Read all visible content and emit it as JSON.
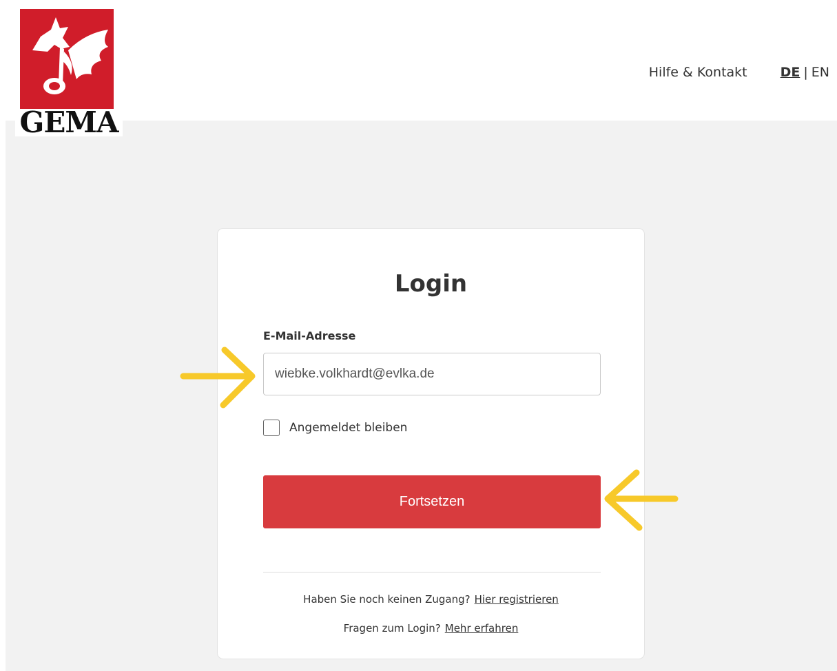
{
  "header": {
    "logo_text": "GEMA",
    "help_link": "Hilfe & Kontakt",
    "lang_de": "DE",
    "lang_separator": "|",
    "lang_en": "EN"
  },
  "login": {
    "title": "Login",
    "email_label": "E-Mail-Adresse",
    "email_value": "wiebke.volkhardt@evlka.de",
    "remember_label": "Angemeldet bleiben",
    "remember_checked": false,
    "continue_label": "Fortsetzen"
  },
  "footer": {
    "register_prompt": "Haben Sie noch keinen Zugang?",
    "register_link": "Hier registrieren",
    "faq_prompt": "Fragen zum Login?",
    "faq_link": "Mehr erfahren"
  },
  "colors": {
    "brand_red": "#d01d2a",
    "button_red": "#d83b3e",
    "background_grey": "#f2f2f2",
    "annotation_arrow": "#f7c92a"
  },
  "icons": {
    "logo": "gema-pegasus-logo",
    "annotations": "yellow-arrow-icon"
  }
}
